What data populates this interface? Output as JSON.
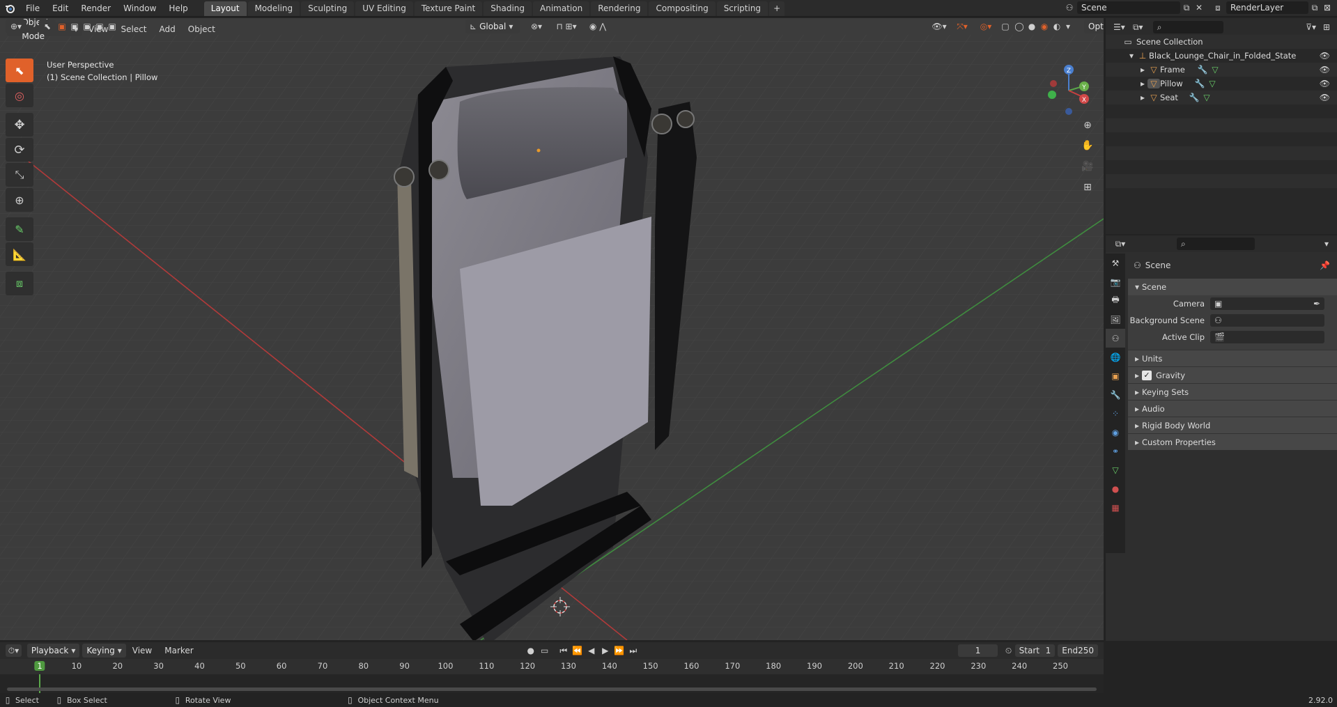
{
  "topbar": {
    "menus": [
      "File",
      "Edit",
      "Render",
      "Window",
      "Help"
    ],
    "workspaces": [
      "Layout",
      "Modeling",
      "Sculpting",
      "UV Editing",
      "Texture Paint",
      "Shading",
      "Animation",
      "Rendering",
      "Compositing",
      "Scripting"
    ],
    "active_workspace": "Layout",
    "add_workspace": "+",
    "scene_name": "Scene",
    "view_layer": "RenderLayer"
  },
  "viewport_header": {
    "mode": "Object Mode",
    "menus": [
      "View",
      "Select",
      "Add",
      "Object"
    ],
    "orientation": "Global",
    "options": "Options"
  },
  "viewport": {
    "perspective": "User Perspective",
    "collection_info": "(1) Scene Collection | Pillow",
    "gizmo_axes": {
      "z": "Z",
      "y": "Y",
      "x": "X"
    },
    "colors": {
      "x_axis": "#c03a3a",
      "y_axis": "#4a9c4a",
      "active": "#e0612a"
    }
  },
  "outliner": {
    "root": "Scene Collection",
    "collection": "Black_Lounge_Chair_in_Folded_State",
    "objects": [
      "Frame",
      "Pillow",
      "Seat"
    ]
  },
  "properties": {
    "context": "Scene",
    "panel_title": "Scene",
    "fields": [
      {
        "label": "Camera",
        "value": ""
      },
      {
        "label": "Background Scene",
        "value": ""
      },
      {
        "label": "Active Clip",
        "value": ""
      }
    ],
    "subpanels": [
      "Units",
      "Gravity",
      "Keying Sets",
      "Audio",
      "Rigid Body World",
      "Custom Properties"
    ],
    "gravity_checked": true
  },
  "timeline": {
    "menus": [
      "Playback",
      "Keying",
      "View",
      "Marker"
    ],
    "current_frame": "1",
    "start_label": "Start",
    "start": "1",
    "end_label": "End",
    "end": "250",
    "ruler": [
      "1",
      "10",
      "20",
      "30",
      "40",
      "50",
      "60",
      "70",
      "80",
      "90",
      "100",
      "110",
      "120",
      "130",
      "140",
      "150",
      "160",
      "170",
      "180",
      "190",
      "200",
      "210",
      "220",
      "230",
      "240",
      "250"
    ]
  },
  "statusbar": {
    "select": "Select",
    "box_select": "Box Select",
    "rotate_view": "Rotate View",
    "context_menu": "Object Context Menu",
    "version": "2.92.0"
  }
}
